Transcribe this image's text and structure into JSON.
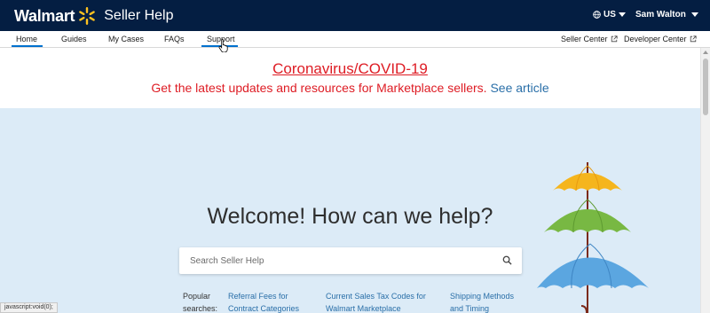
{
  "header": {
    "brand": "Walmart",
    "product": "Seller Help",
    "locale": "US",
    "user_name": "Sam Walton"
  },
  "nav": {
    "items": [
      {
        "label": "Home",
        "active": true
      },
      {
        "label": "Guides"
      },
      {
        "label": "My Cases"
      },
      {
        "label": "FAQs"
      },
      {
        "label": "Support",
        "hovered": true
      }
    ],
    "right": [
      {
        "label": "Seller Center",
        "icon": "external-link-icon"
      },
      {
        "label": "Developer Center",
        "icon": "external-link-icon"
      }
    ]
  },
  "alert": {
    "title": "Coronavirus/COVID-19",
    "body": "Get the latest updates and resources for Marketplace sellers.",
    "link": "See article"
  },
  "hero": {
    "title": "Welcome! How can we help?",
    "search_placeholder": "Search Seller Help",
    "popular_label": "Popular searches:",
    "popular_links": [
      "Referral Fees for Contract Categories",
      "Current Sales Tax Codes for Walmart Marketplace",
      "Shipping Methods and Timing"
    ]
  },
  "status_bar": "javascript:void(0);",
  "colors": {
    "header_bg": "#041e42",
    "spark": "#ffc220",
    "accent": "#0071ce",
    "alert": "#de1c24",
    "link": "#2a6fa8",
    "hero_bg": "#dcebf7"
  }
}
